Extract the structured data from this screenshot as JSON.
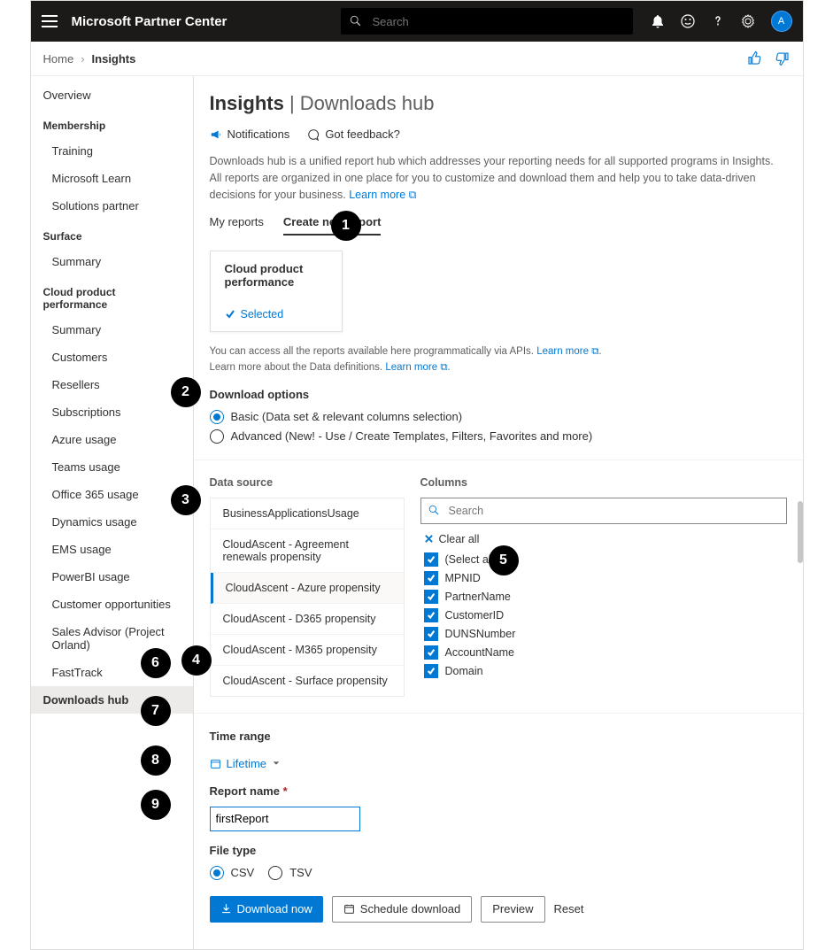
{
  "topbar": {
    "brand": "Microsoft Partner Center",
    "search_placeholder": "Search",
    "avatar_initial": "A"
  },
  "breadcrumb": {
    "home": "Home",
    "current": "Insights"
  },
  "sidebar": {
    "overview": "Overview",
    "membership_head": "Membership",
    "training": "Training",
    "microsoft_learn": "Microsoft Learn",
    "solutions_partner": "Solutions partner",
    "surface_head": "Surface",
    "summary1": "Summary",
    "cpp_head": "Cloud product performance",
    "summary2": "Summary",
    "customers": "Customers",
    "resellers": "Resellers",
    "subscriptions": "Subscriptions",
    "azure_usage": "Azure usage",
    "teams_usage": "Teams usage",
    "o365_usage": "Office 365 usage",
    "dynamics_usage": "Dynamics usage",
    "ems_usage": "EMS usage",
    "powerbi_usage": "PowerBI usage",
    "customer_opp": "Customer opportunities",
    "sales_advisor": "Sales Advisor (Project Orland)",
    "fasttrack": "FastTrack",
    "downloads_hub": "Downloads hub"
  },
  "page": {
    "title_main": "Insights",
    "title_sub": "| Downloads hub",
    "action_notifications": "Notifications",
    "action_feedback": "Got feedback?",
    "description": "Downloads hub is a unified report hub which addresses your reporting needs for all supported programs in Insights. All reports are organized in one place for you to customize and download them and help you to take  data-driven decisions for your business.",
    "learn_more": "Learn more",
    "tabs": {
      "my_reports": "My reports",
      "create_new": "Create new report"
    },
    "card": {
      "title": "Cloud product performance",
      "selected": "Selected"
    },
    "hint_line1": "You can access all the reports available here programmatically via APIs.",
    "hint_learn_more1": "Learn more",
    "hint_line2a": "Learn more about the Data definitions.",
    "hint_learn_more2": "Learn more",
    "download_options_label": "Download options",
    "opt_basic": "Basic (Data set & relevant columns selection)",
    "opt_advanced": "Advanced (New! - Use / Create Templates, Filters, Favorites and more)",
    "col_datasource": "Data source",
    "col_columns": "Columns",
    "columns_search_placeholder": "Search",
    "clear_all": "Clear all",
    "data_sources": [
      "BusinessApplicationsUsage",
      "CloudAscent - Agreement renewals propensity",
      "CloudAscent - Azure propensity",
      "CloudAscent - D365 propensity",
      "CloudAscent - M365 propensity",
      "CloudAscent - Surface propensity"
    ],
    "columns_list": [
      "(Select all)",
      "MPNID",
      "PartnerName",
      "CustomerID",
      "DUNSNumber",
      "AccountName",
      "Domain"
    ],
    "time_range_label": "Time range",
    "time_range_value": "Lifetime",
    "report_name_label": "Report name",
    "report_name_value": "firstReport",
    "file_type_label": "File type",
    "file_type_csv": "CSV",
    "file_type_tsv": "TSV",
    "btn_download_now": "Download now",
    "btn_schedule": "Schedule download",
    "btn_preview": "Preview",
    "btn_reset": "Reset"
  },
  "callouts": [
    "1",
    "2",
    "3",
    "4",
    "5",
    "6",
    "7",
    "8",
    "9"
  ]
}
